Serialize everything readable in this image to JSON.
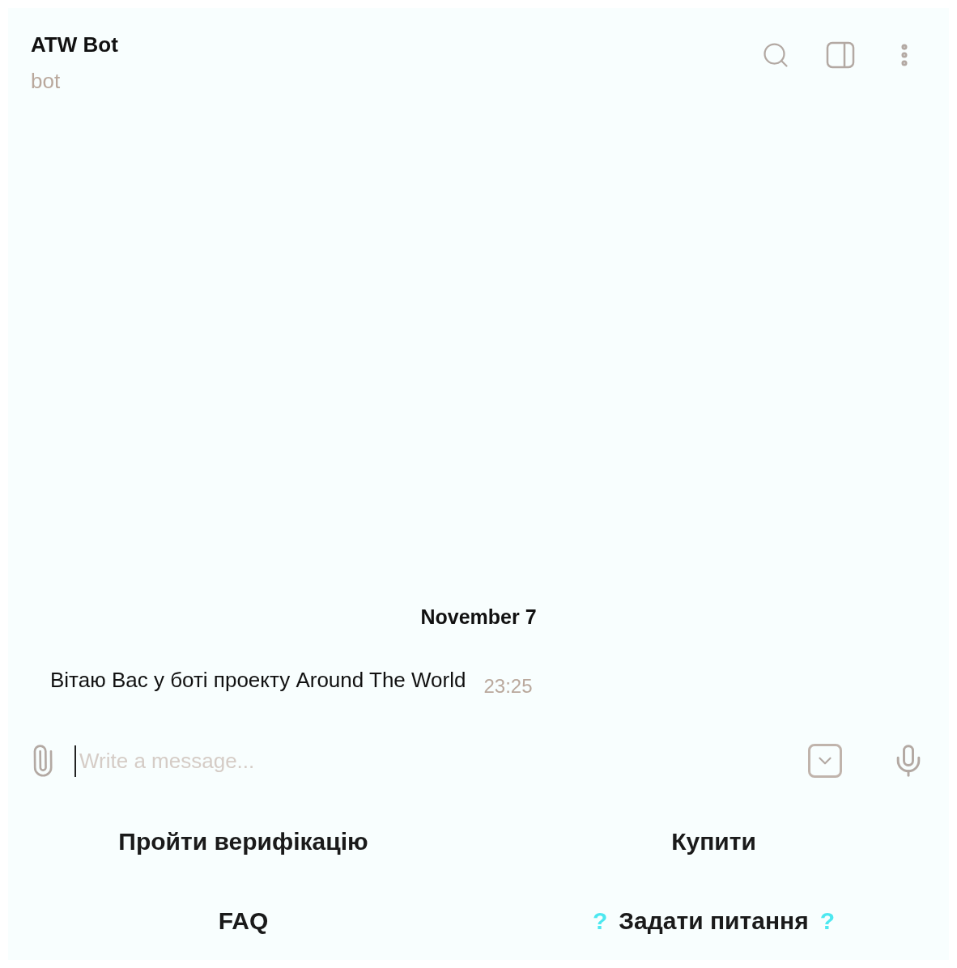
{
  "header": {
    "title": "ATW Bot",
    "subtitle": "bot"
  },
  "date_separator": "November 7",
  "messages": [
    {
      "text": "Вітаю Вас у боті проекту Around The World",
      "time": "23:25"
    }
  ],
  "composer": {
    "placeholder": "Write a message..."
  },
  "keyboard": [
    {
      "label": "Пройти верифікацію"
    },
    {
      "label": "Купити"
    },
    {
      "label": "FAQ"
    },
    {
      "label": "Задати питання",
      "prefix": "?",
      "suffix": "?"
    }
  ]
}
